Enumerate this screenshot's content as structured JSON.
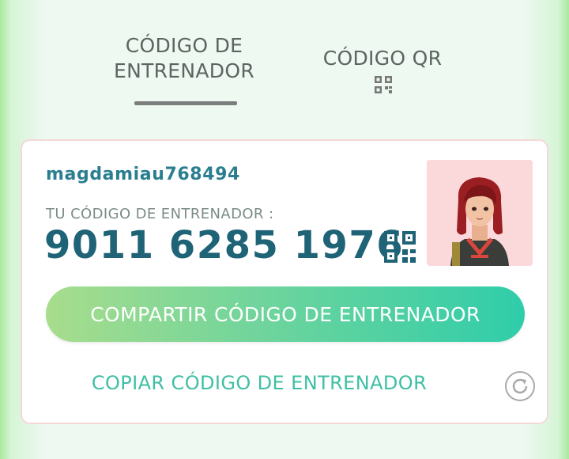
{
  "tabs": {
    "trainer_code_label": "CÓDIGO DE ENTRENADOR",
    "trainer_code_line1": "CÓDIGO DE",
    "trainer_code_line2": "ENTRENADOR",
    "qr_code_label": "CÓDIGO QR",
    "active": "trainer_code"
  },
  "card": {
    "username": "magdamiau768494",
    "code_label": "TU CÓDIGO DE ENTRENADOR :",
    "code_value": "9011 6285 1976",
    "share_button_label": "COMPARTIR CÓDIGO DE ENTRENADOR",
    "copy_link_label": "COPIAR CÓDIGO DE ENTRENADOR"
  },
  "icons": {
    "tab_qr": "qr-icon",
    "card_qr": "qr-code-icon",
    "refresh": "refresh-icon"
  },
  "colors": {
    "tab_text": "#5f6462",
    "username": "#2a7e8f",
    "code_value": "#1f6377",
    "share_gradient_start": "#a8dd8c",
    "share_gradient_end": "#2fcdaa",
    "copy_link": "#3fbfa3",
    "avatar_bg": "#fbd9db"
  }
}
